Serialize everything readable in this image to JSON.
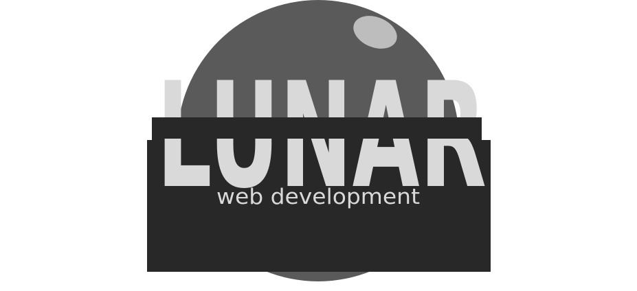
{
  "logo": {
    "wordmark": "LUNAR",
    "tagline": "web development",
    "colors": {
      "background": "#ffffff",
      "moon": "#5a5a5a",
      "crater": "#bdbdbd",
      "block": "#282828",
      "wordmark": "#d9d9d9",
      "tagline": "#d9d9d9"
    },
    "icons": [
      "moon-icon",
      "crater-icon"
    ]
  }
}
